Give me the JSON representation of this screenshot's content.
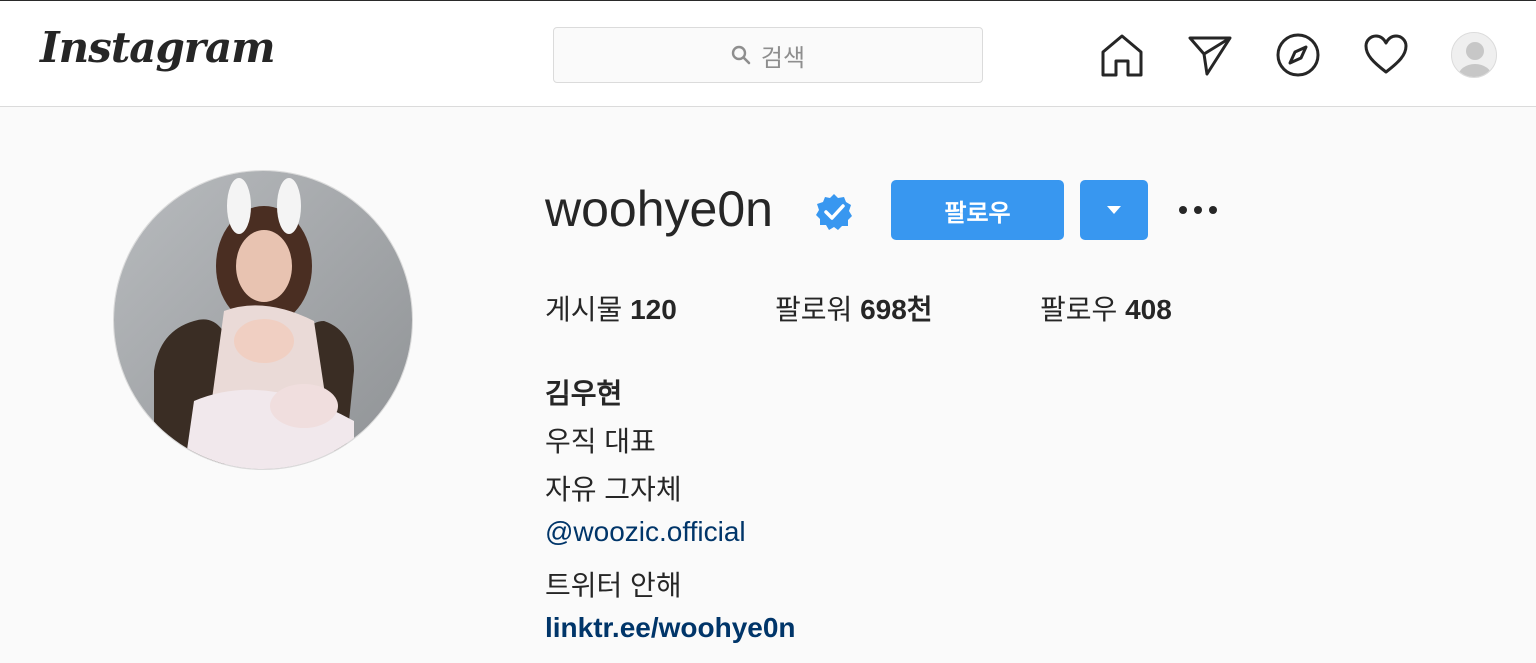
{
  "header": {
    "logo_text": "Instagram",
    "search_placeholder": "검색",
    "icons": [
      "home-icon",
      "direct-icon",
      "explore-icon",
      "activity-heart-icon",
      "profile-avatar"
    ]
  },
  "profile": {
    "username": "woohye0n",
    "verified": true,
    "follow_label": "팔로우",
    "stats": {
      "posts_label": "게시물",
      "posts_count": "120",
      "followers_label": "팔로워",
      "followers_count": "698천",
      "following_label": "팔로우",
      "following_count": "408"
    },
    "bio": {
      "name": "김우현",
      "line1": "우직 대표",
      "line2": "자유 그자체",
      "mention": "@woozic.official",
      "line3": "트위터 안해",
      "url": "linktr.ee/woohye0n"
    }
  },
  "colors": {
    "accent": "#3897f0",
    "link": "#003569",
    "text": "#262626",
    "background": "#fafafa",
    "border": "#dbdbdb"
  }
}
